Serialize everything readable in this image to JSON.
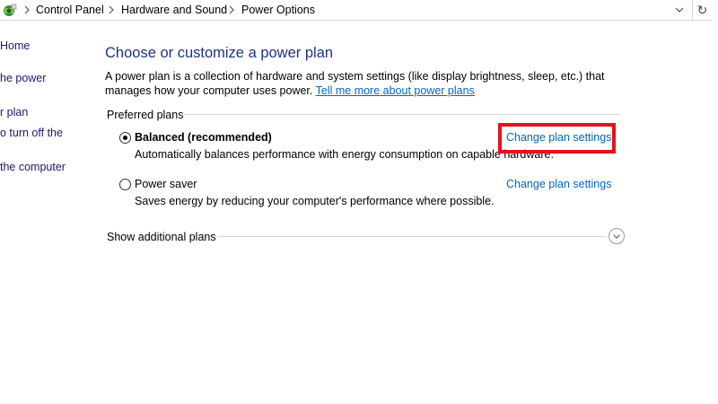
{
  "address_bar": {
    "breadcrumbs": [
      "Control Panel",
      "Hardware and Sound",
      "Power Options"
    ],
    "icon": "control-panel-icon",
    "refresh_icon": "↻"
  },
  "sidebar": {
    "links": [
      "Home",
      "he power",
      "r plan",
      "o turn off the",
      "the computer"
    ]
  },
  "main": {
    "title": "Choose or customize a power plan",
    "description": "A power plan is a collection of hardware and system settings (like display brightness, sleep, etc.) that manages how your computer uses power.",
    "learn_more_link": "Tell me more about power plans",
    "preferred_plans_label": "Preferred plans",
    "plans": [
      {
        "name": "Balanced (recommended)",
        "selected": true,
        "description": "Automatically balances performance with energy consumption on capable hardware.",
        "link": "Change plan settings"
      },
      {
        "name": "Power saver",
        "selected": false,
        "description": "Saves energy by reducing your computer's performance where possible.",
        "link": "Change plan settings"
      }
    ],
    "show_additional_label": "Show additional plans"
  },
  "colors": {
    "title": "#1e3287",
    "link": "#0066cc",
    "sidebar_link": "#1a1a6e",
    "highlight": "#e3131b"
  }
}
